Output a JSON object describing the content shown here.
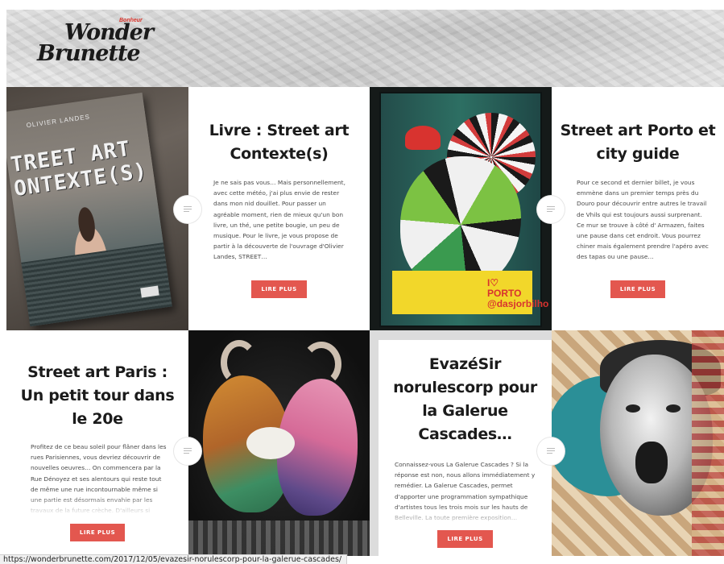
{
  "header": {
    "logo_line1": "Wonder",
    "logo_line2": "Brunette",
    "logo_badge": "Bonheur"
  },
  "posts": [
    {
      "title": "Livre : Street art Contexte(s)",
      "excerpt": "Je ne sais pas vous… Mais personnellement, avec cette météo, j'ai plus envie de rester dans mon nid douillet. Pour passer un agréable moment, rien de mieux qu'un bon livre, un thé, une petite bougie, un peu de musique. Pour le livre, je vous propose de partir à la découverte de l'ouvrage d'Olivier Landes, STREET…",
      "button": "LIRE PLUS"
    },
    {
      "title": "Street art Porto et city guide",
      "excerpt": "Pour ce second et dernier billet, je vous emmène dans un premier temps près du Douro pour découvrir entre autres le travail de Vhils qui est toujours aussi surprenant. Ce mur se trouve à côté d' Armazen, faites une pause dans cet endroit. Vous pourrez chiner mais également prendre l'apéro avec des tapas ou une pause…",
      "button": "LIRE PLUS"
    },
    {
      "title": "Street art Paris : Un petit tour dans le 20e",
      "excerpt": "Profitez de ce beau soleil pour flâner dans les rues Parisiennes, vous devriez découvrir de nouvelles oeuvres… On commencera par la Rue Dénoyez et ses alentours qui reste tout de même une rue incontournable même si une partie est désormais envahie par les travaux de la future crèche. D'ailleurs si vous…",
      "button": "LIRE PLUS"
    },
    {
      "title": "EvazéSir norulescorp pour la Galerue Cascades…",
      "excerpt": "Connaissez-vous La Galerue Cascades ? Si la réponse est non, nous allons immédiatement y remédier. La Galerue Cascades, permet d'apporter une programmation sympathique d'artistes tous les trois mois sur les hauts de Belleville. La toute première exposition…",
      "button": "LIRE PLUS"
    }
  ],
  "photos": {
    "book_author": "OLIVIER LANDES",
    "book_title_l1": "TREET ART",
    "book_title_l2": "ONTEXTE(S)",
    "rooster_tag_l1": "I♡",
    "rooster_tag_l2": "PORTO",
    "rooster_tag_l3": "@dasjorbilho"
  },
  "status_bar": {
    "url": "https://wonderbrunette.com/2017/12/05/evazesir-norulescorp-pour-la-galerue-cascades/"
  },
  "colors": {
    "accent": "#e3574f",
    "title": "#1b1b1b",
    "body_text": "#4a4a4a"
  }
}
